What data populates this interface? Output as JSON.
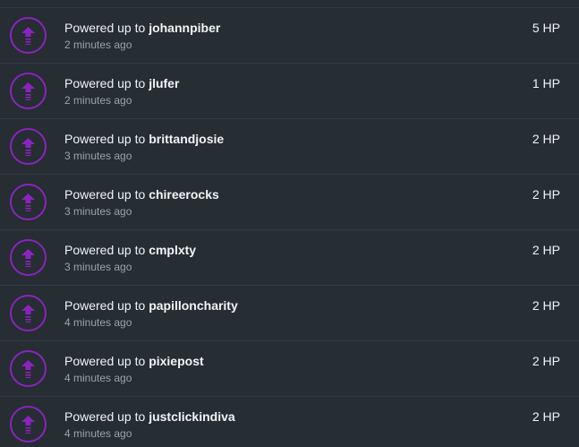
{
  "colors": {
    "background": "#262d33",
    "divider": "#323b43",
    "icon_accent": "#8a24bd",
    "primary_text": "#f2f4f6",
    "secondary_text": "#9aa4ad"
  },
  "activity": {
    "action_text": "Powered up to",
    "items": [
      {
        "icon": "power-up-arrow-icon",
        "user": "johannpiber",
        "time": "2 minutes ago",
        "amount": "5 HP"
      },
      {
        "icon": "power-up-arrow-icon",
        "user": "jlufer",
        "time": "2 minutes ago",
        "amount": "1 HP"
      },
      {
        "icon": "power-up-arrow-icon",
        "user": "brittandjosie",
        "time": "3 minutes ago",
        "amount": "2 HP"
      },
      {
        "icon": "power-up-arrow-icon",
        "user": "chireerocks",
        "time": "3 minutes ago",
        "amount": "2 HP"
      },
      {
        "icon": "power-up-arrow-icon",
        "user": "cmplxty",
        "time": "3 minutes ago",
        "amount": "2 HP"
      },
      {
        "icon": "power-up-arrow-icon",
        "user": "papilloncharity",
        "time": "4 minutes ago",
        "amount": "2 HP"
      },
      {
        "icon": "power-up-arrow-icon",
        "user": "pixiepost",
        "time": "4 minutes ago",
        "amount": "2 HP"
      },
      {
        "icon": "power-up-arrow-icon",
        "user": "justclickindiva",
        "time": "4 minutes ago",
        "amount": "2 HP"
      }
    ]
  }
}
